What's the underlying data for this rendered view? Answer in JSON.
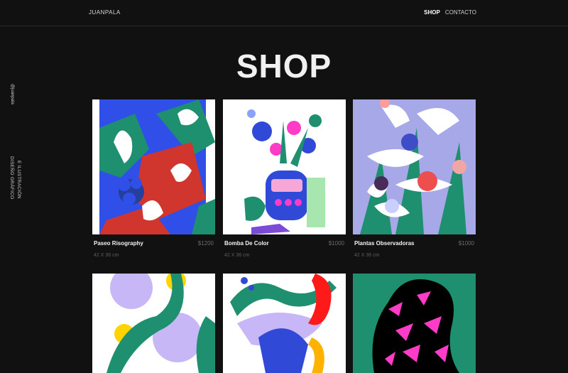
{
  "header": {
    "brand": "JUANPALA",
    "nav": [
      "SHOP",
      "CONTACTO"
    ]
  },
  "sidebar": {
    "handle": "@juanpala",
    "lines": [
      "DISEÑO GRÁFICO",
      "E ILUSTRACIÓN"
    ]
  },
  "page": {
    "title": "SHOP"
  },
  "products": [
    {
      "name": "Paseo Risography",
      "price": "$1200",
      "size": "42 X 36 cm"
    },
    {
      "name": "Bomba De Color",
      "price": "$1000",
      "size": "42 X 36 cm"
    },
    {
      "name": "Plantas Observadoras",
      "price": "$1000",
      "size": "42 X 36 cm"
    }
  ],
  "colors": {
    "background": "#121111",
    "accent_teal": "#1e8f6f",
    "accent_pink": "#ff3cc7"
  }
}
